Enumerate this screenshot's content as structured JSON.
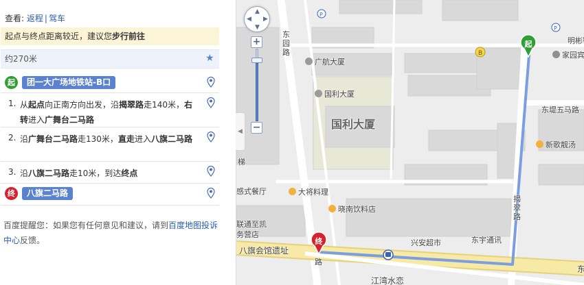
{
  "panel": {
    "view_prefix": "查看:",
    "view_links": [
      "返程",
      "驾车"
    ],
    "view_separator": "|",
    "tip_text": "起点与终点距离较近，建议您",
    "tip_strong": "步行前往",
    "distance": "约270米",
    "start": {
      "badge": "起",
      "name": "团一大广场地铁站-B口"
    },
    "steps": [
      {
        "num": "1.",
        "parts": [
          {
            "t": "从"
          },
          {
            "t": "起点",
            "b": true
          },
          {
            "t": "向正南方向出发，沿"
          },
          {
            "t": "揭翠路",
            "b": true
          },
          {
            "t": "走140米，"
          },
          {
            "t": "右转",
            "b": true
          },
          {
            "t": "进入"
          },
          {
            "t": "广舞台二马路",
            "b": true
          }
        ]
      },
      {
        "num": "2.",
        "parts": [
          {
            "t": "沿"
          },
          {
            "t": "广舞台二马路",
            "b": true
          },
          {
            "t": "走130米，"
          },
          {
            "t": "直走",
            "b": true
          },
          {
            "t": "进入"
          },
          {
            "t": "八旗二马路",
            "b": true
          }
        ]
      },
      {
        "num": "3.",
        "parts": [
          {
            "t": "沿"
          },
          {
            "t": "八旗二马路",
            "b": true
          },
          {
            "t": "走10米，到达"
          },
          {
            "t": "终点",
            "b": true
          }
        ]
      }
    ],
    "end": {
      "badge": "终",
      "name": "八旗二马路"
    },
    "footer_prefix": "百度提醒您：如果您有任何意见和建议，请到",
    "footer_link": "百度地图投诉中心",
    "footer_suffix": "反馈。"
  },
  "map": {
    "labels": {
      "dongyuan_road": "东园路",
      "guanghang": "广航大厦",
      "guoli_small": "国利大厦",
      "guoli_big": "国利大厦",
      "mingbin": "明彬鄂",
      "jiayuan": "家园宾",
      "dongdi": "东堤五马路",
      "xinge": "新歌靓汤",
      "ti": "梯",
      "ganshi": "感式餐厅",
      "dajiang": "大将料理",
      "xiaonan": "晓南饮料店",
      "lianhai": "联通至凯",
      "yingye": "务营店",
      "baqi": "八旗会馆遗址",
      "jiecui": "揭翠路",
      "xingan": "兴安超市",
      "dongyu": "东宇通讯",
      "jiangwan": "江湾水恋",
      "road_lu": "路",
      "east_edge": "东"
    },
    "markers": {
      "start": "起",
      "end": "终"
    },
    "nav": {
      "zoom_in": "+",
      "zoom_out": "−"
    },
    "colors": {
      "route": "#7b9ee0",
      "road_yellow": "#f7e9a6",
      "block": "#d9d9d9",
      "start": "#2f9e35",
      "end": "#d4232c"
    }
  }
}
